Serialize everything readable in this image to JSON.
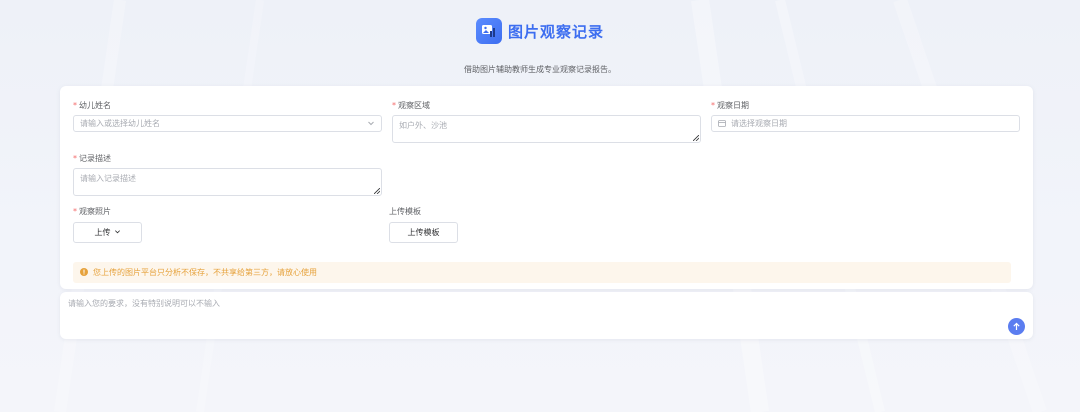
{
  "header": {
    "logo_icon": "photo-chart-icon",
    "title": "图片观察记录",
    "subtitle": "借助图片辅助教师生成专业观察记录报告。"
  },
  "form": {
    "child_name": {
      "label": "幼儿姓名",
      "required": true,
      "placeholder": "请输入或选择幼儿姓名"
    },
    "area": {
      "label": "观察区域",
      "required": true,
      "placeholder": "如户外、沙池"
    },
    "date": {
      "label": "观察日期",
      "required": true,
      "placeholder": "请选择观察日期"
    },
    "description": {
      "label": "记录描述",
      "required": true,
      "placeholder": "请输入记录描述"
    },
    "photos": {
      "label": "观察照片",
      "required": true,
      "button": "上传"
    },
    "template": {
      "label": "上传模板",
      "required": false,
      "button": "上传模板"
    }
  },
  "notice": {
    "text": "您上传的图片平台只分析不保存，不共享给第三方，请放心使用",
    "color": "#e6a23c"
  },
  "prompt": {
    "placeholder": "请输入您的要求，没有特别说明可以不输入",
    "send_icon": "arrow-up-icon"
  },
  "required_mark": "*",
  "colors": {
    "accent": "#3d6ef0",
    "required": "#f56c6c",
    "send": "#5b7df0"
  }
}
